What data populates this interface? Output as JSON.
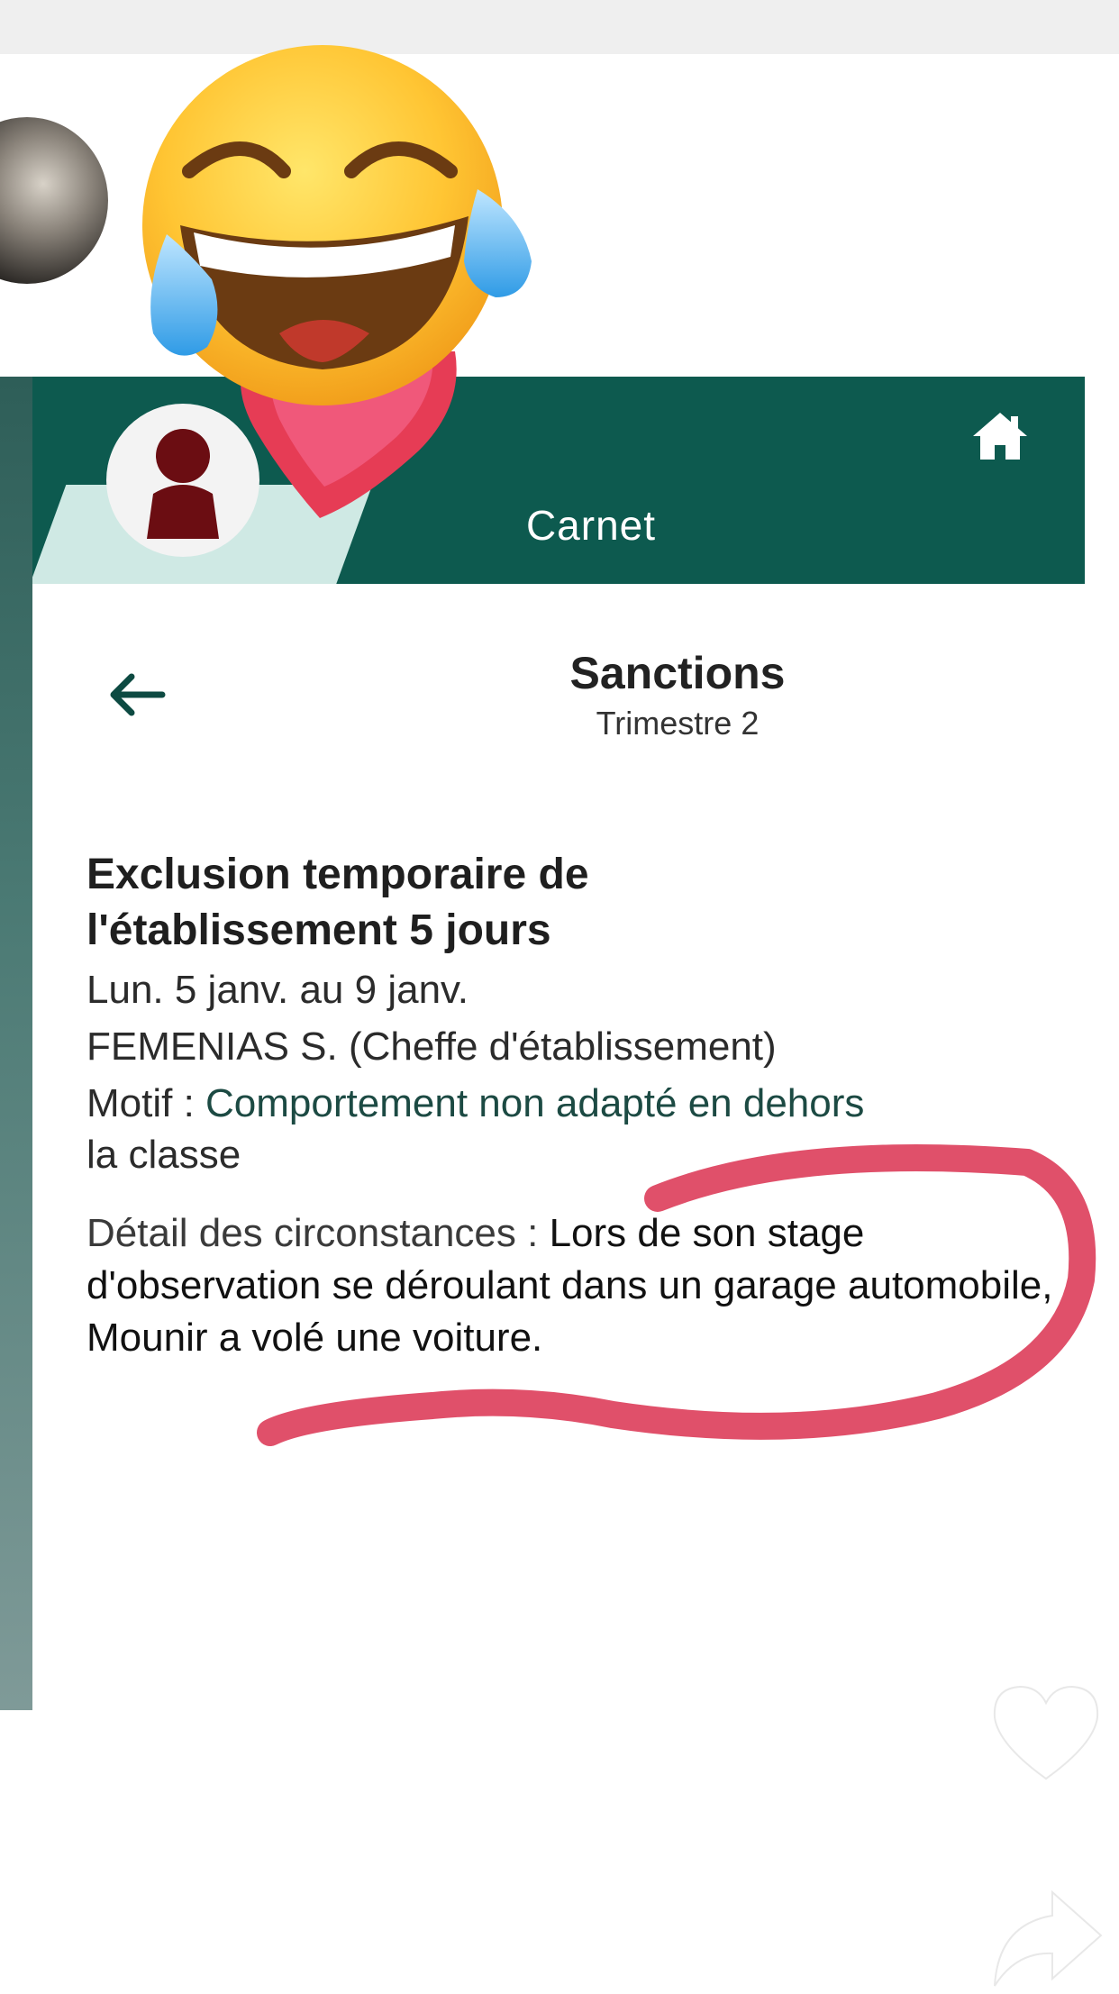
{
  "header": {
    "title": "Carnet",
    "home_icon": "home-icon",
    "accent_color": "#0d5a4f"
  },
  "page": {
    "title": "Sanctions",
    "subtitle": "Trimestre 2",
    "back_icon": "back-arrow-icon"
  },
  "sanction": {
    "title_line1": "Exclusion temporaire de",
    "title_line2": "l'établissement 5 jours",
    "dates": "Lun. 5 janv. au 9 janv.",
    "issuer": "FEMENIAS S. (Cheffe d'établissement)",
    "motif_label": "Motif : ",
    "motif_value_line1": "Comportement non adapté en dehors",
    "motif_value_line2": "la classe",
    "details_label": "Détail des circonstances : ",
    "details_value": "Lors de son stage d'observation se déroulant dans un garage automobile, Mounir a volé une voiture."
  },
  "overlay": {
    "emoji": "laughing-tears-emoji",
    "sticker": "heart-sticker",
    "scribble_color": "#e0506a",
    "like_icon": "heart-icon",
    "share_icon": "share-arrow-icon"
  }
}
